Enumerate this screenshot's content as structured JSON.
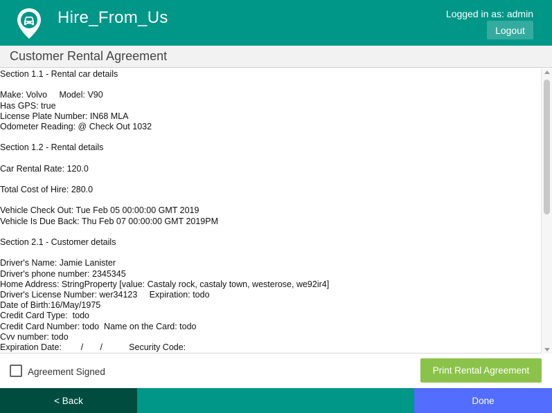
{
  "header": {
    "app_title": "Hire_From_Us",
    "logo_icon": "car-location-pin-icon",
    "logged_in_text": "Logged in as: admin",
    "logout_label": "Logout",
    "color": "#009688"
  },
  "page": {
    "title": "Customer Rental Agreement"
  },
  "agreement": {
    "lines": [
      "Section 1.1 - Rental car details",
      "",
      "Make: Volvo     Model: V90",
      "Has GPS: true",
      "License Plate Number: IN68 MLA",
      "Odometer Reading: @ Check Out 1032",
      "",
      "Section 1.2 - Rental details",
      "",
      "Car Rental Rate: 120.0",
      "",
      "Total Cost of Hire: 280.0",
      "",
      "Vehicle Check Out: Tue Feb 05 00:00:00 GMT 2019",
      "Vehicle Is Due Back: Thu Feb 07 00:00:00 GMT 2019PM",
      "",
      "Section 2.1 - Customer details",
      "",
      "Driver's Name: Jamie Lanister",
      "Driver's phone number: 2345345",
      "Home Address: StringProperty [value: Castaly rock, castaly town, westerose, we92ir4]",
      "Driver's License Number: wer34123     Expiration: todo",
      "Date of Birth:16/May/1975",
      "Credit Card Type:  todo",
      "Credit Card Number: todo  Name on the Card: todo",
      "Cvv number: todo",
      "Expiration Date:        /       /           Security Code:"
    ]
  },
  "controls": {
    "agreement_signed_label": "Agreement Signed",
    "agreement_signed_checked": false,
    "print_label": "Print Rental Agreement",
    "print_color": "#8bc34a"
  },
  "footer": {
    "back_label": "< Back",
    "done_label": "Done",
    "back_color": "#004d40",
    "done_color": "#536dfe"
  }
}
